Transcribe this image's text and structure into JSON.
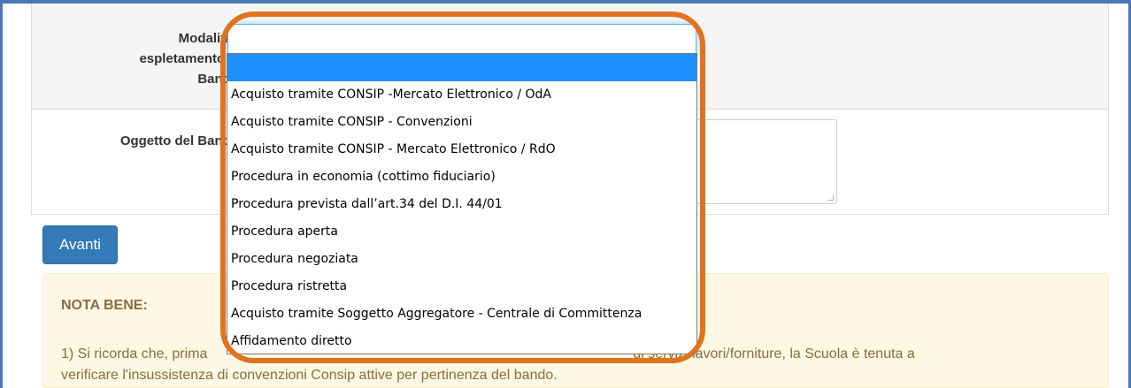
{
  "form": {
    "modalita_label_line1": "Modalità  di",
    "modalita_label_line2": "espletamento del",
    "modalita_label_line3": "Bando",
    "oggetto_label": "Oggetto del Bando",
    "required_mark": "*",
    "modalita_value": ""
  },
  "buttons": {
    "avanti": "Avanti"
  },
  "dropdown": {
    "options": [
      "",
      "Acquisto tramite CONSIP -Mercato Elettronico / OdA",
      "Acquisto tramite CONSIP - Convenzioni",
      "Acquisto tramite CONSIP - Mercato Elettronico / RdO",
      "Procedura in economia (cottimo fiduciario)",
      "Procedura prevista dall’art.34 del D.I. 44/01",
      "Procedura aperta",
      "Procedura negoziata",
      "Procedura ristretta",
      "Acquisto tramite Soggetto Aggregatore - Centrale di Committenza",
      "Affidamento diretto"
    ],
    "selected_index": 0
  },
  "note": {
    "title": "NOTA BENE:",
    "line1_start": "1) Si ricorda che, prima",
    "line1_end": "di servizi/lavori/forniture, la Scuola è tenuta a",
    "line2": "verificare l'insussistenza di convenzioni Consip attive per pertinenza del bando."
  },
  "colors": {
    "primary_button": "#337ab7",
    "highlight_selected": "#1e90ff",
    "annotation_outline": "#e0731f",
    "note_background": "#fcf8e3",
    "required": "#c9302c"
  }
}
